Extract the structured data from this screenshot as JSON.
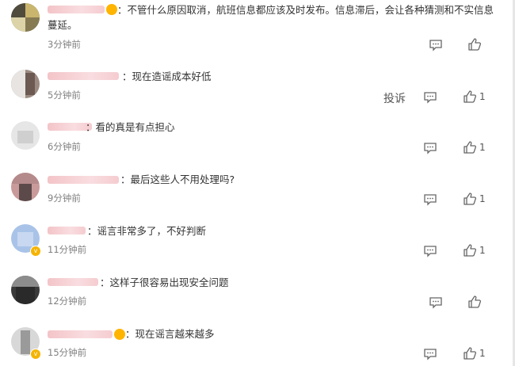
{
  "comments": [
    {
      "text1": "：不管什么原因取消，航班信息都应该及时发布。信息滞后，会让各种猜测和不实信息",
      "text2": "蔓延。",
      "time": "3分钟前",
      "likes": ""
    },
    {
      "text1": "：现在造谣成本好低",
      "time": "5分钟前",
      "report": "投诉",
      "likes": "1"
    },
    {
      "text1": "：看的真是有点担心",
      "time": "6分钟前",
      "likes": "1"
    },
    {
      "text1": "：最后这些人不用处理吗?",
      "time": "9分钟前",
      "likes": "1"
    },
    {
      "text1": "：谣言非常多了，不好判断",
      "time": "11分钟前",
      "likes": "1"
    },
    {
      "text1": "：这样子很容易出现安全问题",
      "time": "12分钟前",
      "likes": ""
    },
    {
      "text1": "：现在谣言越来越多",
      "time": "15分钟前",
      "likes": "1"
    }
  ],
  "icons": {
    "reply": "comment-icon",
    "like": "thumbs-up-icon",
    "verified": "verified-badge-icon"
  }
}
